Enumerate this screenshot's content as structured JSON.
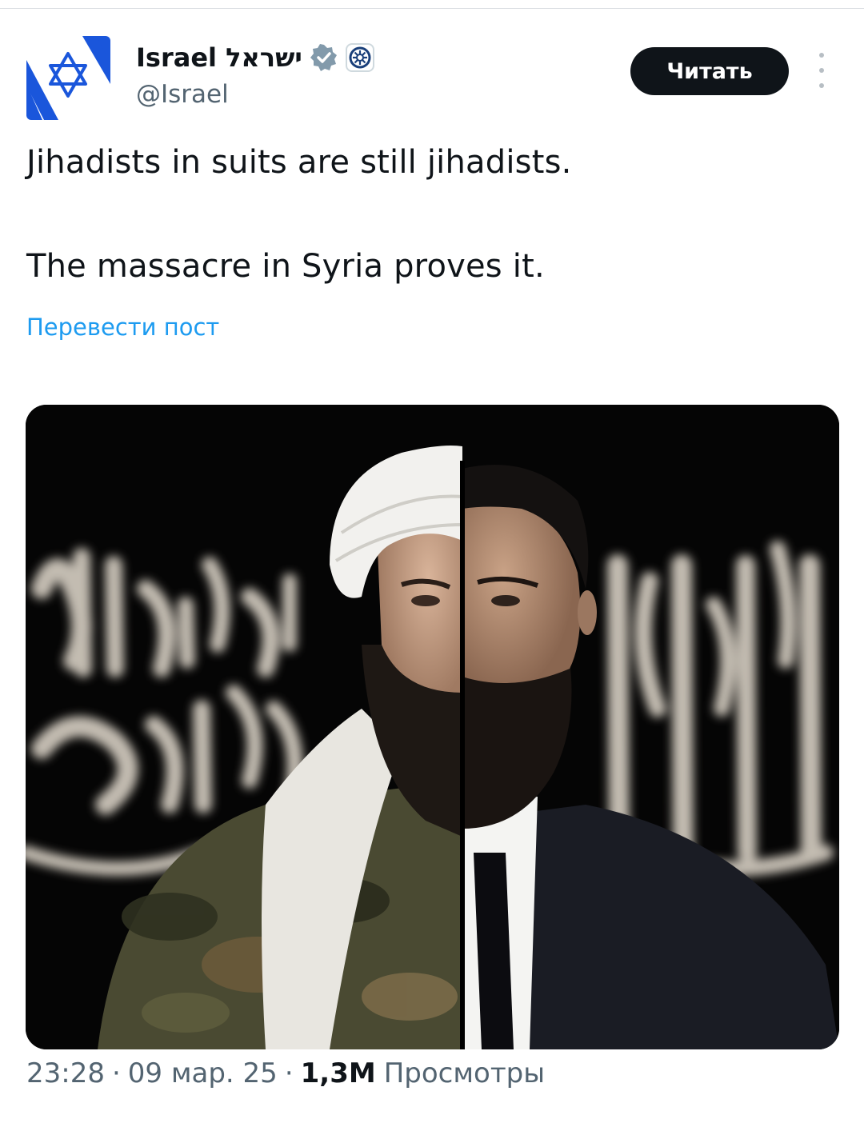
{
  "account": {
    "display_name": "Israel ישראל",
    "handle": "@Israel",
    "avatar_icon": "star-of-david-icon",
    "verified_icon": "verified-badge-icon",
    "affiliate_icon": "government-affiliate-badge-icon"
  },
  "actions": {
    "follow_label": "Читать",
    "more_icon": "more-options-icon"
  },
  "tweet": {
    "line1": "Jihadists in suits are still jihadists.",
    "line2": "The massacre in Syria proves it.",
    "translate_label": "Перевести пост"
  },
  "media": {
    "description_icon": "split-portrait-image"
  },
  "meta": {
    "time": "23:28",
    "separator": "·",
    "date": "09 мар. 25",
    "views_count": "1,3M",
    "views_label": "Просмотры"
  },
  "colors": {
    "text": "#0f1419",
    "secondary": "#536471",
    "link": "#1d9bf0",
    "accent_blue": "#1a56db",
    "verified": "#829aab"
  }
}
